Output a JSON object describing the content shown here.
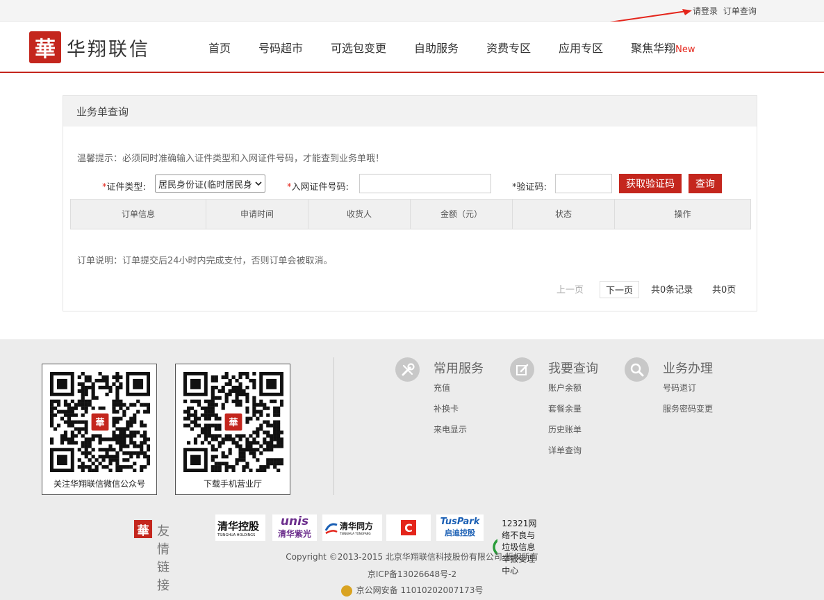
{
  "topbar": {
    "login": "请登录",
    "orders": "订单查询"
  },
  "logo": {
    "mark": "華",
    "text": "华翔联信"
  },
  "nav": [
    {
      "label": "首页"
    },
    {
      "label": "号码超市"
    },
    {
      "label": "可选包变更"
    },
    {
      "label": "自助服务"
    },
    {
      "label": "资费专区"
    },
    {
      "label": "应用专区"
    },
    {
      "label": "聚焦华翔",
      "badge": "New"
    }
  ],
  "panel": {
    "title": "业务单查询",
    "tip": "温馨提示：必须同时准确输入证件类型和入网证件号码，才能查到业务单哦！",
    "id_type_label": "证件类型:",
    "id_type_value": "居民身份证(临时居民身",
    "id_number_label": "入网证件号码:",
    "captcha_label": "*验证码:",
    "get_code_button": "获取验证码",
    "query_button": "查询",
    "table_headers": [
      "订单信息",
      "申请时间",
      "收货人",
      "金额（元）",
      "状态",
      "操作"
    ],
    "note": "订单说明：订单提交后24小时内完成支付，否则订单会被取消。",
    "pager": {
      "prev": "上一页",
      "next": "下一页",
      "total_records": "共0条记录",
      "total_pages": "共0页"
    }
  },
  "footer": {
    "qr": [
      {
        "caption": "关注华翔联信微信公众号"
      },
      {
        "caption": "下载手机营业厅"
      }
    ],
    "services": [
      {
        "title": "常用服务",
        "icon": "tools-icon",
        "items": [
          "充值",
          "补换卡",
          "来电显示"
        ]
      },
      {
        "title": "我要查询",
        "icon": "edit-icon",
        "items": [
          "账户余额",
          "套餐余量",
          "历史账单",
          "详单查询"
        ]
      },
      {
        "title": "业务办理",
        "icon": "search-icon",
        "items": [
          "号码退订",
          "服务密码变更"
        ]
      }
    ],
    "friends_label": "友情链接",
    "friend_links": {
      "thholdings_cn": "清华控股",
      "thholdings_en": "TSINGHUA HOLDINGS",
      "unis_en": "unis",
      "unis_cn": "清华紫光",
      "tongfang_cn": "清华同方",
      "tongfang_en": "TSINGHUA TONGFANG",
      "tuspark_en": "TusPark",
      "tuspark_cn": "启迪控股",
      "report_center": "12321网络不良与垃圾信息举报受理中心"
    },
    "copyright": "Copyright ©2013-2015 北京华翔联信科技股份有限公司 版权所有",
    "icp": "京ICP备13026648号-2",
    "police": "京公网安备 11010202007173号"
  },
  "colors": {
    "brand_red": "#c4261d",
    "new_red": "#e4251b"
  }
}
